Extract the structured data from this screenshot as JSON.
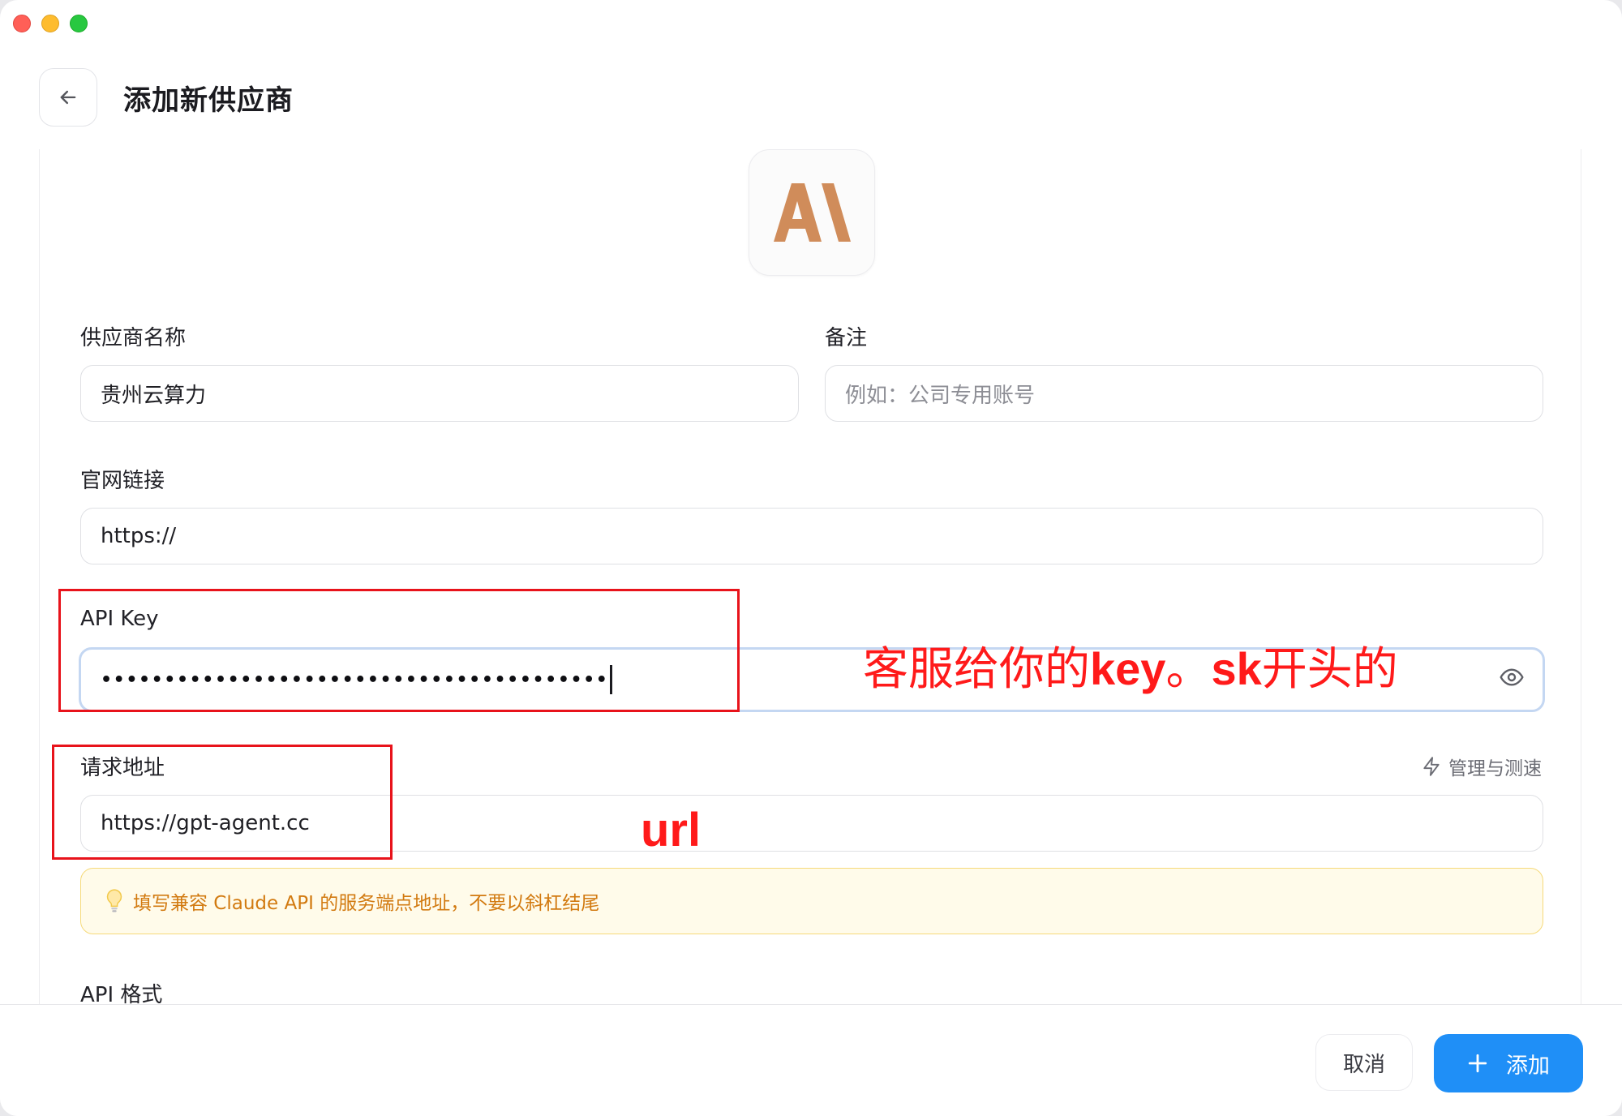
{
  "header": {
    "title": "添加新供应商",
    "back_icon": "arrow-left-icon"
  },
  "logo": {
    "icon": "anthropic-logo",
    "color": "#d08c5a"
  },
  "form": {
    "provider_name": {
      "label": "供应商名称",
      "value": "贵州云算力"
    },
    "note": {
      "label": "备注",
      "placeholder": "例如：公司专用账号"
    },
    "website": {
      "label": "官网链接",
      "value": "https://"
    },
    "api_key": {
      "label": "API Key",
      "masked_value": "••••••••••••••••••••••••••••••••••••••••",
      "toggle_icon": "eye-icon"
    },
    "request_url": {
      "label": "请求地址",
      "value": "https://gpt-agent.cc",
      "manage_label": "管理与测速",
      "manage_icon": "lightning-icon"
    },
    "hint": {
      "icon": "lightbulb-icon",
      "text": "填写兼容 Claude API 的服务端点地址，不要以斜杠结尾"
    },
    "api_format": {
      "label": "API 格式"
    }
  },
  "annotations": {
    "key_note": {
      "part1": "客服给你的",
      "part2": "key",
      "part3": "。",
      "part4": "sk",
      "part5": "开头的"
    },
    "url_note": "url",
    "color": "#ff1a1a"
  },
  "footer": {
    "cancel_label": "取消",
    "add_label": "添加",
    "add_icon": "plus-icon"
  },
  "colors": {
    "accent": "#1f8ff7",
    "hint_bg": "#fffbea",
    "hint_text": "#d27a10"
  }
}
